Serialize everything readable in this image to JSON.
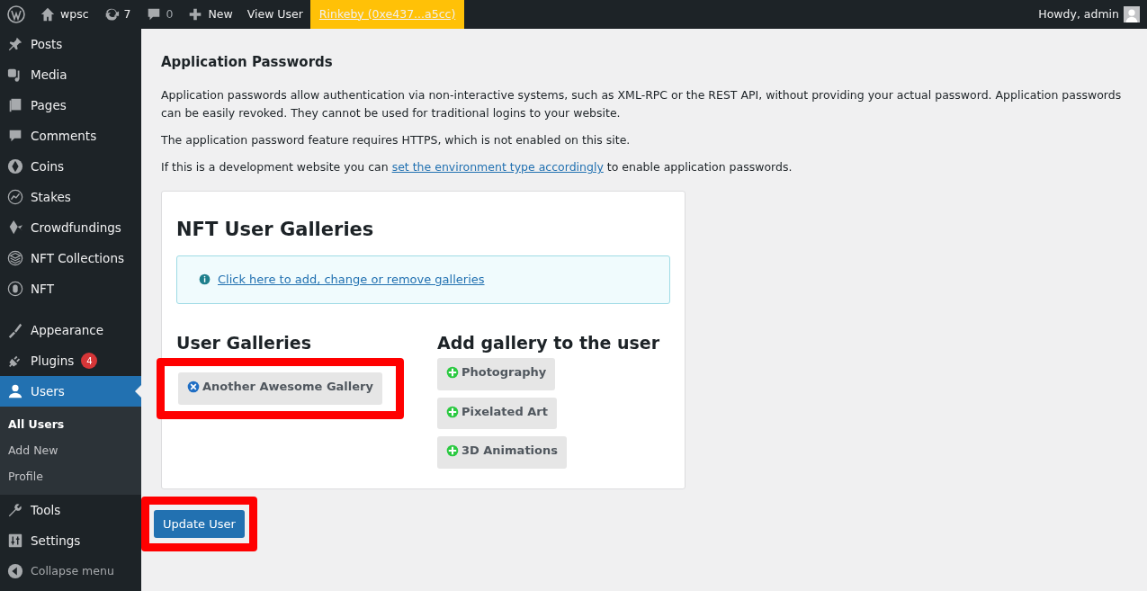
{
  "admin_bar": {
    "site": "wpsc",
    "updates": "7",
    "comments": "0",
    "new": "New",
    "view_user": "View User",
    "network": "Rinkeby (0xe437...a5cc)",
    "howdy": "Howdy, admin"
  },
  "sidebar": {
    "sections": [
      [
        {
          "label": "Posts",
          "selected": false
        },
        {
          "label": "Media",
          "selected": false
        },
        {
          "label": "Pages",
          "selected": false
        },
        {
          "label": "Comments",
          "selected": false
        },
        {
          "label": "Coins",
          "selected": false
        },
        {
          "label": "Stakes",
          "selected": false
        },
        {
          "label": "Crowdfundings",
          "selected": false
        },
        {
          "label": "NFT Collections",
          "selected": false
        },
        {
          "label": "NFT",
          "selected": false
        }
      ],
      [
        {
          "label": "Appearance",
          "selected": false
        },
        {
          "label": "Plugins",
          "selected": false,
          "badge": "4"
        },
        {
          "label": "Users",
          "selected": true,
          "children": [
            {
              "label": "All Users",
              "selected": true
            },
            {
              "label": "Add New",
              "selected": false
            },
            {
              "label": "Profile",
              "selected": false
            }
          ]
        },
        {
          "label": "Tools",
          "selected": false
        },
        {
          "label": "Settings",
          "selected": false
        }
      ]
    ],
    "collapse": "Collapse menu"
  },
  "app_passwords": {
    "title": "Application Passwords",
    "paragraphs": [
      "Application passwords allow authentication via non-interactive systems, such as XML-RPC or the REST API, without providing your actual password. Application passwords can be easily revoked. They cannot be used for traditional logins to your website.",
      "The application password feature requires HTTPS, which is not enabled on this site."
    ],
    "dev_note": {
      "before": "If this is a development website you can ",
      "link": "set the environment type accordingly",
      "after": " to enable application passwords."
    }
  },
  "galleries_card": {
    "title": "NFT User Galleries",
    "notice_link": "Click here to add, change or remove galleries",
    "user_galleries": {
      "title": "User Galleries",
      "highlighted": true,
      "items": [
        "Another Awesome Gallery"
      ]
    },
    "add_gallery": {
      "title": "Add gallery to the user",
      "items": [
        "Photography",
        "Pixelated Art",
        "3D Animations"
      ]
    }
  },
  "submit": {
    "label": "Update User",
    "highlighted": true
  }
}
